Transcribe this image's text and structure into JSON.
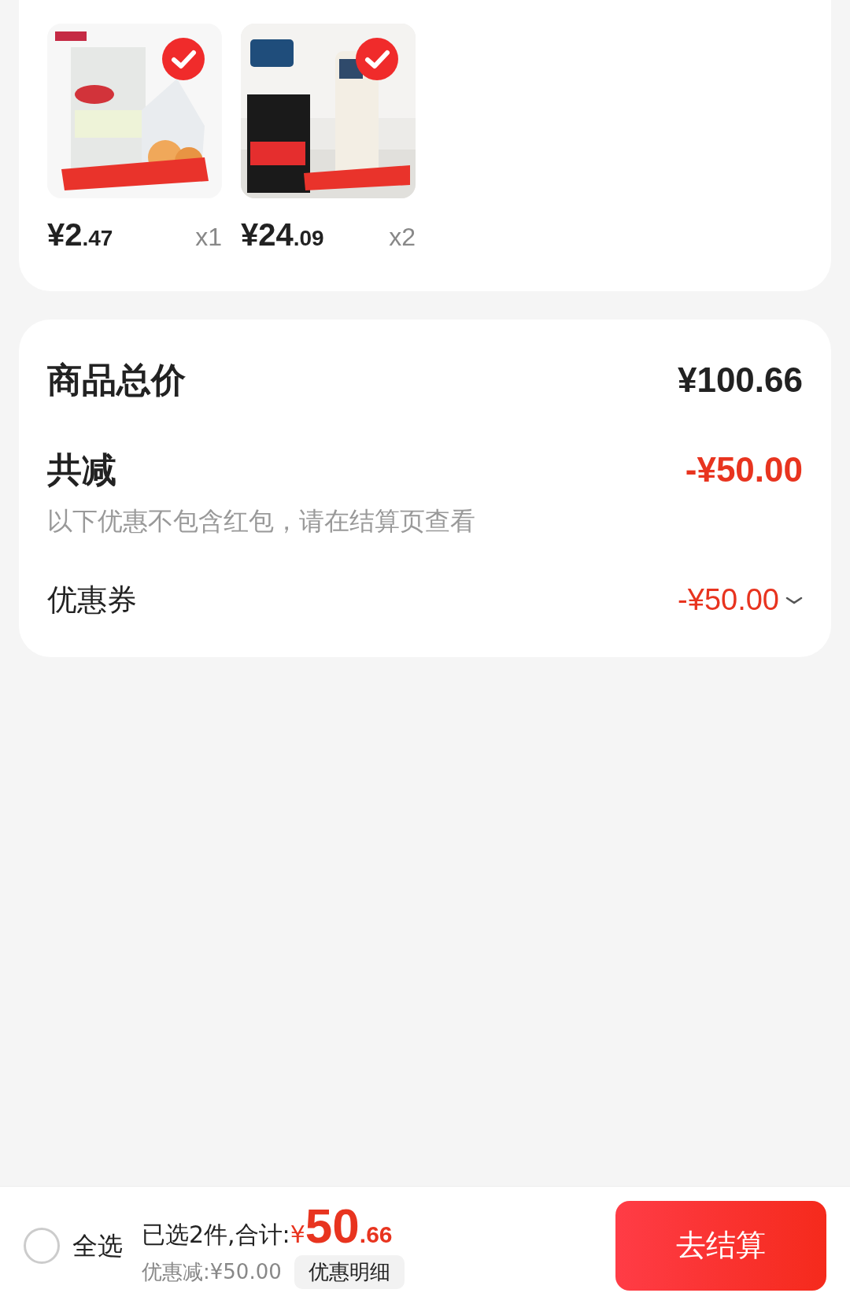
{
  "products": [
    {
      "selected": true,
      "price_main": "¥2",
      "price_decimal": ".47",
      "quantity": "x1"
    },
    {
      "selected": true,
      "price_main": "¥24",
      "price_decimal": ".09",
      "quantity": "x2"
    }
  ],
  "summary": {
    "rows": [
      {
        "kind": "total",
        "label": "商品总价",
        "value": "¥100.66"
      },
      {
        "kind": "discount",
        "label": "共减",
        "value": "-¥50.00",
        "note": "以下优惠不包含红包，请在结算页查看"
      },
      {
        "kind": "coupon",
        "label": "优惠券",
        "value": "-¥50.00",
        "expanded": false
      }
    ]
  },
  "bottom_bar": {
    "select_all": {
      "label": "全选",
      "selected": false
    },
    "selected_text": "已选2件,合计:",
    "currency": "¥",
    "total_main": "50",
    "total_decimal": ".66",
    "discount_text": "优惠减:¥50.00",
    "detail_button": "优惠明细",
    "checkout_button": "去结算"
  }
}
